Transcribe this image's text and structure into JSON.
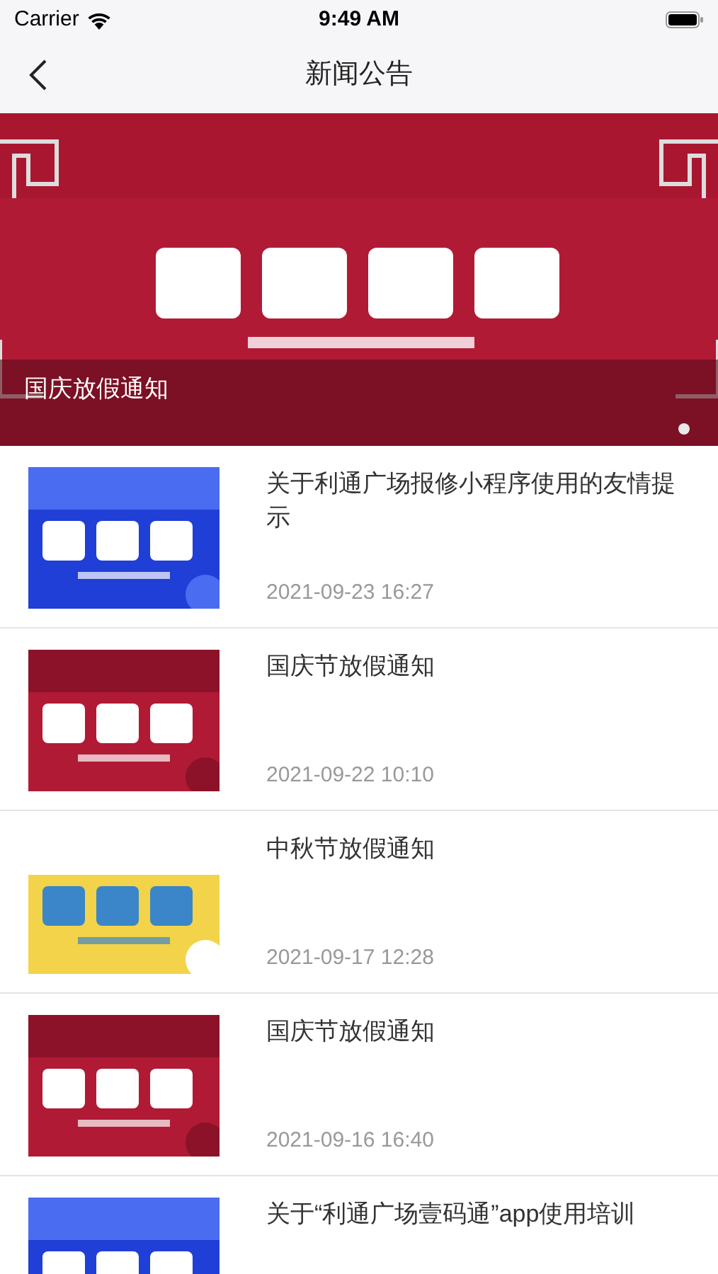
{
  "status_bar": {
    "carrier": "Carrier",
    "time": "9:49 AM"
  },
  "nav": {
    "title": "新闻公告"
  },
  "banner": {
    "caption": "国庆放假通知",
    "dots": [
      {
        "selected": true
      }
    ]
  },
  "news": [
    {
      "title": "关于利通广场报修小程序使用的友情提示",
      "date": "2021-09-23 16:27"
    },
    {
      "title": "国庆节放假通知",
      "date": "2021-09-22 10:10"
    },
    {
      "title": "中秋节放假通知",
      "date": "2021-09-17 12:28"
    },
    {
      "title": "国庆节放假通知",
      "date": "2021-09-16 16:40"
    },
    {
      "title": "关于“利通广场壹码通”app使用培训"
    }
  ]
}
